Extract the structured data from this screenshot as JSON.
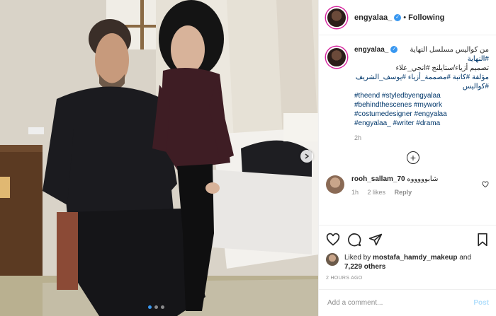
{
  "header": {
    "username": "engyalaa_",
    "separator": "•",
    "follow_label": "Following"
  },
  "caption": {
    "username": "engyalaa_",
    "line1": "من كواليس مسلسل النهاية",
    "line2": "#النهاية",
    "line3": "تصميم أزياء/ستايلنج #انجي_علاء",
    "line4": "مؤلفة #كاتبة #مصممة_أزياء #يوسف_الشريف",
    "line5": "#كواليس",
    "line6": "#theend #styledbyengyalaa",
    "line7": "#behindthescenes #mywork",
    "line8": "#costumedesigner #engyalaa",
    "line9": "#engyalaa_ #writer #drama",
    "time": "2h"
  },
  "comment": {
    "username": "rooh_sallam_70",
    "text": "شابوووووه",
    "time": "1h",
    "likes": "2 likes",
    "reply": "Reply"
  },
  "likes": {
    "prefix": "Liked by",
    "user": "mostafa_hamdy_makeup",
    "and": "and",
    "others": "7,229 others"
  },
  "time_ago": "2 HOURS AGO",
  "add_comment": {
    "placeholder": "Add a comment...",
    "post_label": "Post"
  }
}
